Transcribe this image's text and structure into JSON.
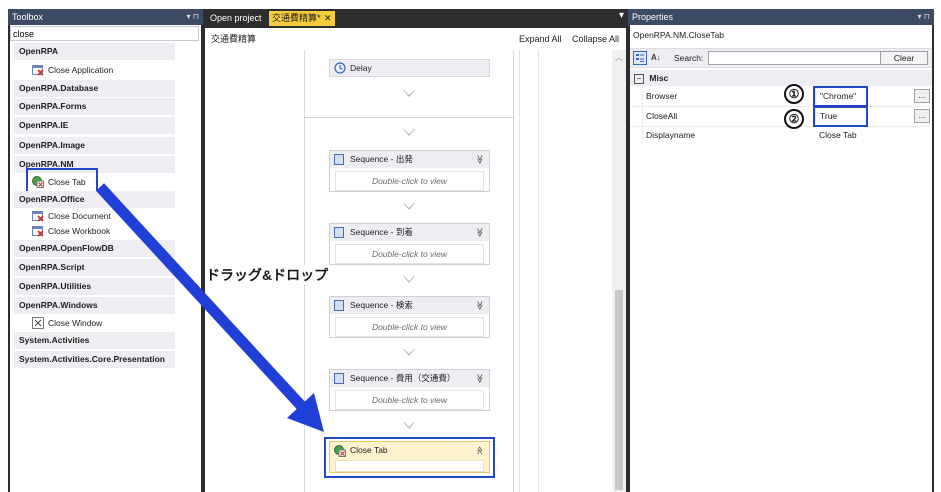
{
  "toolbox": {
    "title": "Toolbox",
    "pin": "▾ ⊓",
    "search_value": "close",
    "categories": [
      {
        "name": "OpenRPA"
      },
      {
        "name": "OpenRPA.Database"
      },
      {
        "name": "OpenRPA.Forms"
      },
      {
        "name": "OpenRPA.IE"
      },
      {
        "name": "OpenRPA.Image"
      },
      {
        "name": "OpenRPA.NM"
      },
      {
        "name": "OpenRPA.Office"
      },
      {
        "name": "OpenRPA.OpenFlowDB"
      },
      {
        "name": "OpenRPA.Script"
      },
      {
        "name": "OpenRPA.Utilities"
      },
      {
        "name": "OpenRPA.Windows"
      },
      {
        "name": "System.Activities"
      },
      {
        "name": "System.Activities.Core.Presentation"
      }
    ],
    "tools": {
      "close_application": "Close Application",
      "close_tab": "Close Tab",
      "close_document": "Close Document",
      "close_workbook": "Close Workbook",
      "close_window": "Close Window"
    }
  },
  "editor": {
    "tabs": [
      {
        "label": "Open project",
        "active": false
      },
      {
        "label": "交通費精算*",
        "active": true
      }
    ],
    "tab_close": "✕",
    "dropdown": "▾",
    "breadcrumb": "交通費精算",
    "expand_all": "Expand All",
    "collapse_all": "Collapse All",
    "delay_label": "Delay",
    "sequences": [
      {
        "label": "Sequence - 出発",
        "hint": "Double-click to view"
      },
      {
        "label": "Sequence - 到着",
        "hint": "Double-click to view"
      },
      {
        "label": "Sequence - 検索",
        "hint": "Double-click to view"
      },
      {
        "label": "Sequence - 費用（交通費）",
        "hint": "Double-click to view"
      }
    ],
    "close_tab_activity": "Close Tab",
    "annotation": "ドラッグ&ドロップ",
    "chevron_down": "≫",
    "chevron_up": "≪"
  },
  "properties": {
    "title": "Properties",
    "pin": "▾ ⊓",
    "object_name": "OpenRPA.NM.CloseTab",
    "search_label": "Search:",
    "search_value": "",
    "clear_button": "Clear",
    "group": "Misc",
    "rows": [
      {
        "name": "Browser",
        "value": "\"Chrome\"",
        "marker": "①"
      },
      {
        "name": "CloseAll",
        "value": "True",
        "marker": "②"
      },
      {
        "name": "Displayname",
        "value": "Close Tab",
        "marker": ""
      }
    ],
    "ellipsis": "..."
  },
  "colors": {
    "header": "#3c4a64",
    "highlight": "#2446c8",
    "annotation_arrow": "#1f3fd6",
    "active_tab": "#f5cc3d",
    "close_tab_activity": "#fff3cf"
  }
}
